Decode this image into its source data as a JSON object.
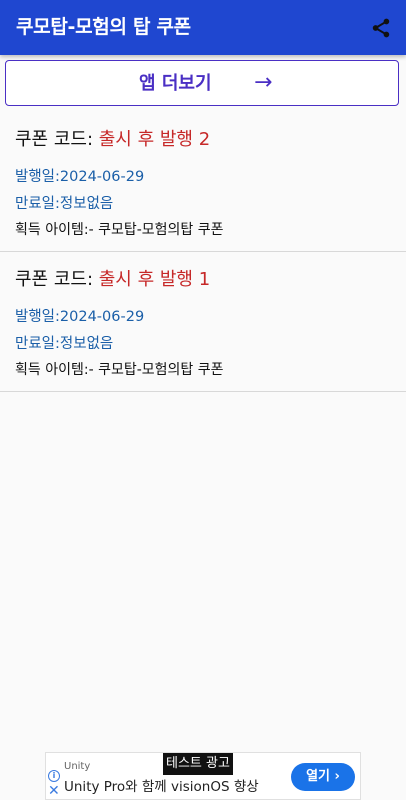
{
  "app_bar": {
    "title": "쿠모탑-모험의 탑 쿠폰",
    "share_icon": "share-icon"
  },
  "more_button": {
    "label": "앱 더보기",
    "arrow": "→"
  },
  "coupons": [
    {
      "code_label": "쿠폰 코드: ",
      "code": "출시 후 발행 2",
      "issued": "발행일:2024-06-29",
      "expires": "만료일:정보없음",
      "item": "획득 아이템:- 쿠모탑-모험의탑 쿠폰"
    },
    {
      "code_label": "쿠폰 코드: ",
      "code": "출시 후 발행 1",
      "issued": "발행일:2024-06-29",
      "expires": "만료일:정보없음",
      "item": "획득 아이템:- 쿠모탑-모험의탑 쿠폰"
    }
  ],
  "ad": {
    "test_label": "테스트 광고",
    "advertiser": "Unity",
    "headline": "Unity Pro와 함께 visionOS 향상",
    "cta": "열기",
    "info_icon": "info-icon",
    "close_icon": "close-icon"
  },
  "colors": {
    "app_bar": "#1f47d0",
    "button_accent": "#4a2fc4",
    "coupon_code": "#c62828",
    "date_text": "#1b5fa8"
  }
}
